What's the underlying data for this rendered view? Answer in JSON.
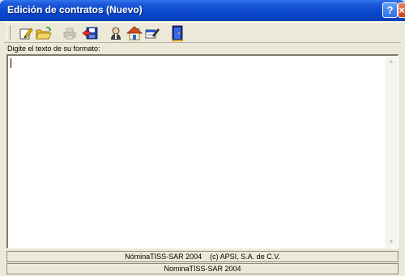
{
  "window": {
    "title": "Edición de contratos (Nuevo)",
    "help_label": "?",
    "close_label": "×"
  },
  "toolbar": {
    "buttons": [
      {
        "icon": "edit-icon",
        "enabled": true
      },
      {
        "icon": "open-folder-icon",
        "enabled": true
      },
      {
        "icon": "print-icon",
        "enabled": false
      },
      {
        "icon": "save-icon",
        "enabled": true
      },
      {
        "icon": "user-icon",
        "enabled": true
      },
      {
        "icon": "home-icon",
        "enabled": true
      },
      {
        "icon": "form-edit-icon",
        "enabled": true
      },
      {
        "icon": "exit-door-icon",
        "enabled": true
      }
    ]
  },
  "editor": {
    "label": "Digite el texto de su formato:",
    "value": ""
  },
  "status": {
    "line1": "NóminaTISS-SAR 2004    (c) APSI, S.A. de C.V.",
    "line2": "NominaTISS-SAR 2004"
  },
  "colors": {
    "titlebar": "#0a47cf",
    "window_bg": "#ece9d8"
  }
}
